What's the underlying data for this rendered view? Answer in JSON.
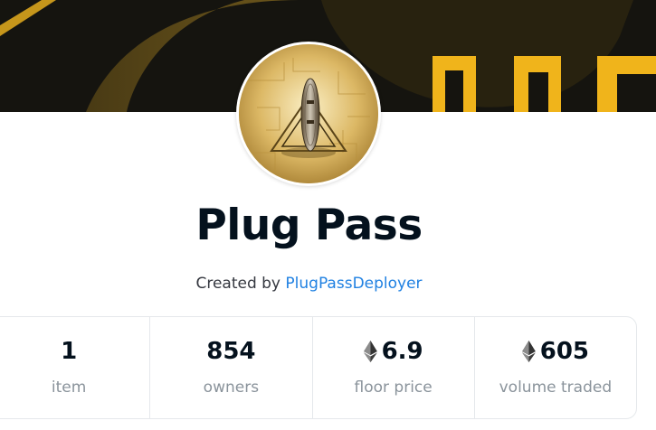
{
  "collection": {
    "name": "Plug Pass",
    "created_by_prefix": "Created by",
    "creator_name": "PlugPassDeployer"
  },
  "stats": [
    {
      "value": "1",
      "label": "item",
      "currency_icon": ""
    },
    {
      "value": "854",
      "label": "owners",
      "currency_icon": ""
    },
    {
      "value": "6.9",
      "label": "floor price",
      "currency_icon": "ethereum-icon"
    },
    {
      "value": "605",
      "label": "volume traded",
      "currency_icon": "ethereum-icon"
    }
  ],
  "colors": {
    "banner_dark": "#15140f",
    "banner_gold": "#f0b41b",
    "title": "#04111d",
    "link": "#2081e2",
    "muted": "#8a939b",
    "border": "#e5e8eb"
  }
}
